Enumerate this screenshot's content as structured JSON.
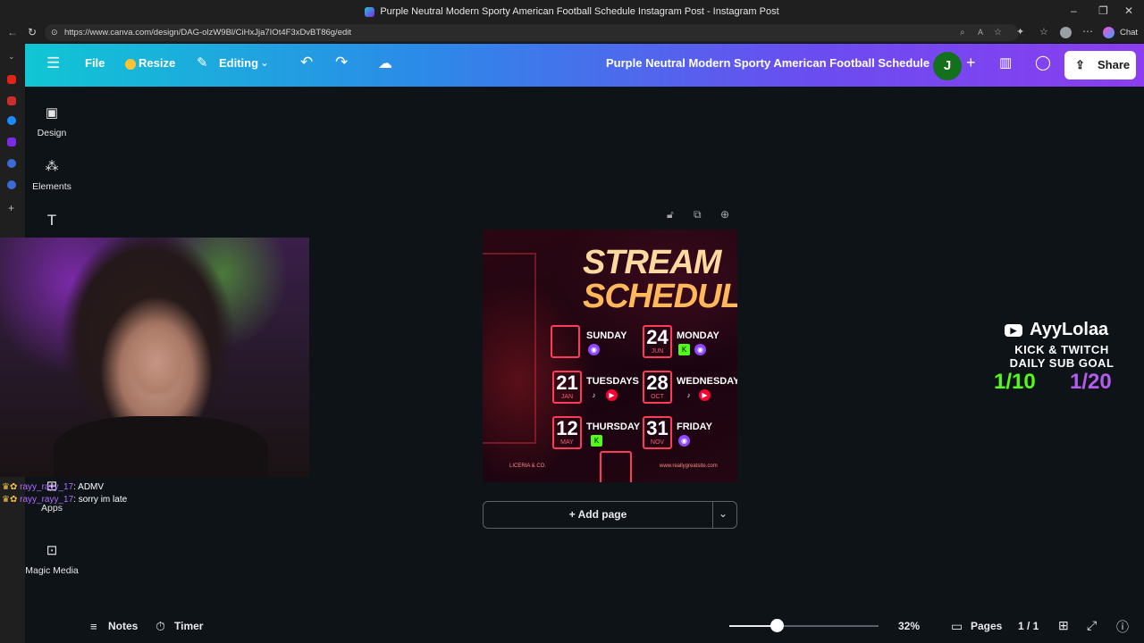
{
  "browser": {
    "window_title": "Purple Neutral Modern Sporty American Football Schedule Instagram Post - Instagram Post",
    "url": "https://www.canva.com/design/DAG-olzW9Bl/CiHxJja7IOt4F3xDvBT86g/edit",
    "chat_button": "Chat"
  },
  "header": {
    "file_label": "File",
    "resize_label": "Resize",
    "editing_label": "Editing",
    "doc_title": "Purple Neutral Modern Sporty American Football Schedule ...",
    "avatar_letter": "J",
    "share_label": "Share"
  },
  "sidebar": {
    "items": [
      {
        "label": "Design"
      },
      {
        "label": "Elements"
      },
      {
        "label": "Apps"
      },
      {
        "label": "Magic Media"
      }
    ]
  },
  "chat": {
    "messages": [
      {
        "user": "rayy_rayy_17",
        "text": ": ADMV"
      },
      {
        "user": "rayy_rayy_17",
        "text": ": sorry im late"
      }
    ]
  },
  "design": {
    "title_line1": "STREAM",
    "title_line2": "SCHEDULE",
    "days": [
      {
        "num": "",
        "month": "",
        "name": "SUNDAY"
      },
      {
        "num": "24",
        "month": "JUN",
        "name": "MONDAY"
      },
      {
        "num": "21",
        "month": "JAN",
        "name": "TUESDAYS"
      },
      {
        "num": "28",
        "month": "OCT",
        "name": "WEDNESDAYS"
      },
      {
        "num": "12",
        "month": "MAY",
        "name": "THURSDAY"
      },
      {
        "num": "31",
        "month": "NOV",
        "name": "FRIDAY"
      }
    ],
    "footer_left": "LICERIA & CO.",
    "footer_right": "www.reallygreatsite.com"
  },
  "add_page_label": "+ Add page",
  "overlay": {
    "channel": "AyyLolaa",
    "line1": "KICK & TWITCH",
    "line2": "DAILY SUB GOAL",
    "goal_kick": "1/10",
    "goal_twitch": "1/20",
    "colors": {
      "kick": "#53fc18",
      "twitch": "#a970ff"
    }
  },
  "footer": {
    "notes_label": "Notes",
    "timer_label": "Timer",
    "zoom": "32%",
    "zoom_fraction": 0.32,
    "pages_label": "Pages",
    "page_count": "1 / 1"
  },
  "colors": {
    "accent": "#7d2ae8",
    "title_cream": "#ffd9a0",
    "title_orange": "#ffb85a",
    "frame_red": "#ff3a5a"
  }
}
